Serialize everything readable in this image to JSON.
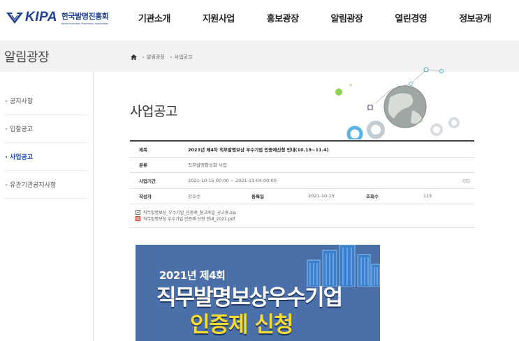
{
  "header": {
    "logo_text": "KIPA",
    "logo_kor": "한국발명진흥회",
    "logo_sub": "Korea Invention Promotion Association",
    "nav": [
      "기관소개",
      "지원사업",
      "홍보광장",
      "알림광장",
      "열린경영",
      "정보공개"
    ]
  },
  "band": {
    "title": "알림광장",
    "breadcrumb": [
      "알림광장",
      "사업공고"
    ]
  },
  "sidebar": {
    "items": [
      {
        "label": "공지사항",
        "active": false
      },
      {
        "label": "입찰공고",
        "active": false
      },
      {
        "label": "사업공고",
        "active": true
      },
      {
        "label": "유관기관공지사항",
        "active": false
      }
    ]
  },
  "content": {
    "title": "사업공고",
    "rows": {
      "subject_label": "제목",
      "subject_value": "2021년 제4차 직무발명보상 우수기업 인증제신청 안내(10.19~11.4)",
      "category_label": "분류",
      "category_value": "직무발명활성화 사업",
      "period_label": "사업기간",
      "period_value": "2021-10-15 00:00 ~ 2021-11-04 00:00",
      "period_extra": "기타",
      "writer_label": "작성자",
      "writer_value": "강호수",
      "date_label": "등록일",
      "date_value": "2021-10-15",
      "views_label": "조회수",
      "views_value": "115"
    },
    "files": [
      {
        "name": "직무발명보상_우수기업_인증제_참고파일_공고용.zip",
        "icon": "zip-file-icon"
      },
      {
        "name": "직무발명보상 우수기업 인증제 신청 안내_2021.pdf",
        "icon": "pdf-file-icon"
      }
    ]
  },
  "banner": {
    "line1": "2021년  제4회",
    "line2": "직무발명보상우수기업",
    "line3": "인증제 신청"
  },
  "colors": {
    "brand": "#1c3f94",
    "active": "#1c4ab8",
    "banner_bg": "#4b6fa8",
    "banner_highlight": "#f7dc2f"
  }
}
